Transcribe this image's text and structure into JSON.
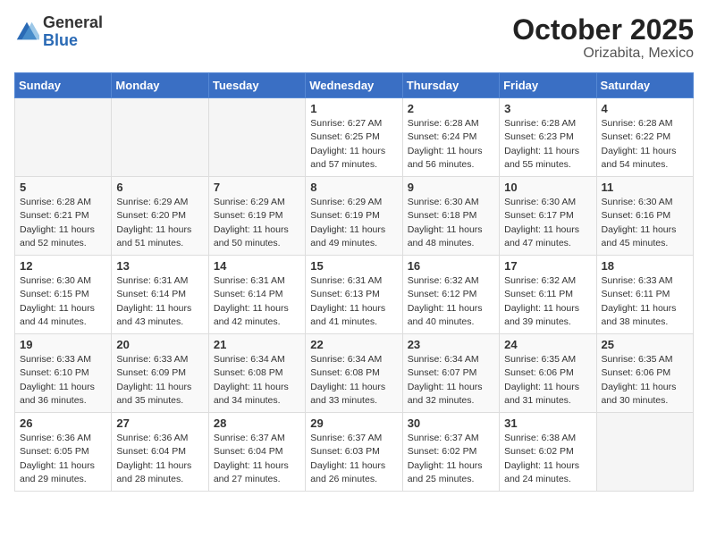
{
  "logo": {
    "general": "General",
    "blue": "Blue"
  },
  "title": "October 2025",
  "subtitle": "Orizabita, Mexico",
  "weekdays": [
    "Sunday",
    "Monday",
    "Tuesday",
    "Wednesday",
    "Thursday",
    "Friday",
    "Saturday"
  ],
  "weeks": [
    [
      {
        "day": "",
        "info": ""
      },
      {
        "day": "",
        "info": ""
      },
      {
        "day": "",
        "info": ""
      },
      {
        "day": "1",
        "info": "Sunrise: 6:27 AM\nSunset: 6:25 PM\nDaylight: 11 hours\nand 57 minutes."
      },
      {
        "day": "2",
        "info": "Sunrise: 6:28 AM\nSunset: 6:24 PM\nDaylight: 11 hours\nand 56 minutes."
      },
      {
        "day": "3",
        "info": "Sunrise: 6:28 AM\nSunset: 6:23 PM\nDaylight: 11 hours\nand 55 minutes."
      },
      {
        "day": "4",
        "info": "Sunrise: 6:28 AM\nSunset: 6:22 PM\nDaylight: 11 hours\nand 54 minutes."
      }
    ],
    [
      {
        "day": "5",
        "info": "Sunrise: 6:28 AM\nSunset: 6:21 PM\nDaylight: 11 hours\nand 52 minutes."
      },
      {
        "day": "6",
        "info": "Sunrise: 6:29 AM\nSunset: 6:20 PM\nDaylight: 11 hours\nand 51 minutes."
      },
      {
        "day": "7",
        "info": "Sunrise: 6:29 AM\nSunset: 6:19 PM\nDaylight: 11 hours\nand 50 minutes."
      },
      {
        "day": "8",
        "info": "Sunrise: 6:29 AM\nSunset: 6:19 PM\nDaylight: 11 hours\nand 49 minutes."
      },
      {
        "day": "9",
        "info": "Sunrise: 6:30 AM\nSunset: 6:18 PM\nDaylight: 11 hours\nand 48 minutes."
      },
      {
        "day": "10",
        "info": "Sunrise: 6:30 AM\nSunset: 6:17 PM\nDaylight: 11 hours\nand 47 minutes."
      },
      {
        "day": "11",
        "info": "Sunrise: 6:30 AM\nSunset: 6:16 PM\nDaylight: 11 hours\nand 45 minutes."
      }
    ],
    [
      {
        "day": "12",
        "info": "Sunrise: 6:30 AM\nSunset: 6:15 PM\nDaylight: 11 hours\nand 44 minutes."
      },
      {
        "day": "13",
        "info": "Sunrise: 6:31 AM\nSunset: 6:14 PM\nDaylight: 11 hours\nand 43 minutes."
      },
      {
        "day": "14",
        "info": "Sunrise: 6:31 AM\nSunset: 6:14 PM\nDaylight: 11 hours\nand 42 minutes."
      },
      {
        "day": "15",
        "info": "Sunrise: 6:31 AM\nSunset: 6:13 PM\nDaylight: 11 hours\nand 41 minutes."
      },
      {
        "day": "16",
        "info": "Sunrise: 6:32 AM\nSunset: 6:12 PM\nDaylight: 11 hours\nand 40 minutes."
      },
      {
        "day": "17",
        "info": "Sunrise: 6:32 AM\nSunset: 6:11 PM\nDaylight: 11 hours\nand 39 minutes."
      },
      {
        "day": "18",
        "info": "Sunrise: 6:33 AM\nSunset: 6:11 PM\nDaylight: 11 hours\nand 38 minutes."
      }
    ],
    [
      {
        "day": "19",
        "info": "Sunrise: 6:33 AM\nSunset: 6:10 PM\nDaylight: 11 hours\nand 36 minutes."
      },
      {
        "day": "20",
        "info": "Sunrise: 6:33 AM\nSunset: 6:09 PM\nDaylight: 11 hours\nand 35 minutes."
      },
      {
        "day": "21",
        "info": "Sunrise: 6:34 AM\nSunset: 6:08 PM\nDaylight: 11 hours\nand 34 minutes."
      },
      {
        "day": "22",
        "info": "Sunrise: 6:34 AM\nSunset: 6:08 PM\nDaylight: 11 hours\nand 33 minutes."
      },
      {
        "day": "23",
        "info": "Sunrise: 6:34 AM\nSunset: 6:07 PM\nDaylight: 11 hours\nand 32 minutes."
      },
      {
        "day": "24",
        "info": "Sunrise: 6:35 AM\nSunset: 6:06 PM\nDaylight: 11 hours\nand 31 minutes."
      },
      {
        "day": "25",
        "info": "Sunrise: 6:35 AM\nSunset: 6:06 PM\nDaylight: 11 hours\nand 30 minutes."
      }
    ],
    [
      {
        "day": "26",
        "info": "Sunrise: 6:36 AM\nSunset: 6:05 PM\nDaylight: 11 hours\nand 29 minutes."
      },
      {
        "day": "27",
        "info": "Sunrise: 6:36 AM\nSunset: 6:04 PM\nDaylight: 11 hours\nand 28 minutes."
      },
      {
        "day": "28",
        "info": "Sunrise: 6:37 AM\nSunset: 6:04 PM\nDaylight: 11 hours\nand 27 minutes."
      },
      {
        "day": "29",
        "info": "Sunrise: 6:37 AM\nSunset: 6:03 PM\nDaylight: 11 hours\nand 26 minutes."
      },
      {
        "day": "30",
        "info": "Sunrise: 6:37 AM\nSunset: 6:02 PM\nDaylight: 11 hours\nand 25 minutes."
      },
      {
        "day": "31",
        "info": "Sunrise: 6:38 AM\nSunset: 6:02 PM\nDaylight: 11 hours\nand 24 minutes."
      },
      {
        "day": "",
        "info": ""
      }
    ]
  ]
}
